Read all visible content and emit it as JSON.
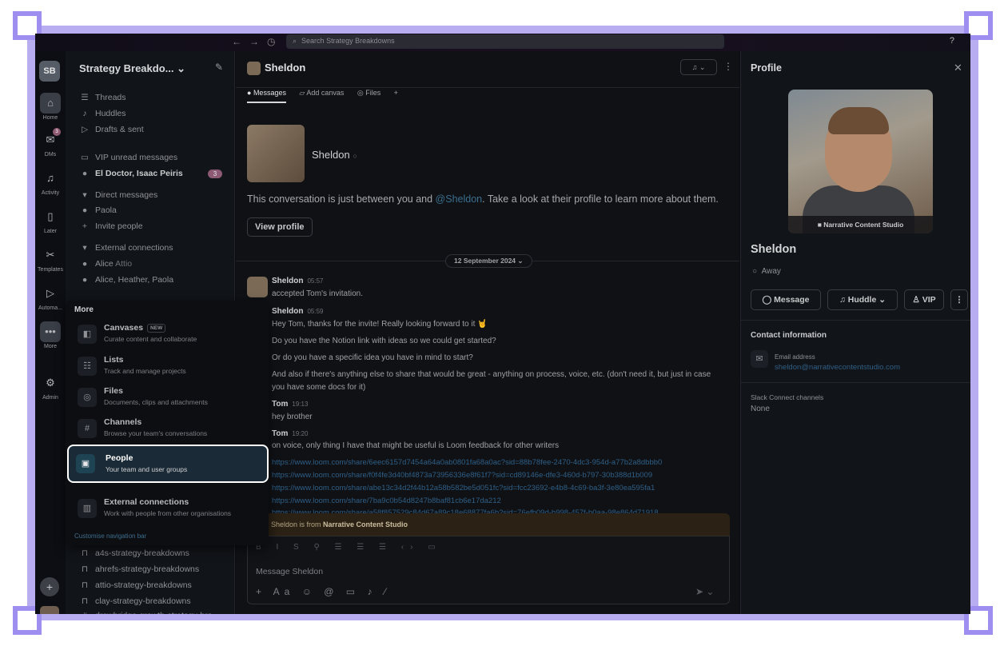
{
  "topbar": {
    "search_placeholder": "Search Strategy Breakdowns",
    "back_icon": "arrow-left-icon",
    "forward_icon": "arrow-right-icon",
    "history_icon": "clock-icon"
  },
  "rail": {
    "workspace_initials": "SB",
    "items": [
      {
        "label": "Home",
        "icon": "home-icon"
      },
      {
        "label": "DMs",
        "icon": "dms-icon",
        "badge": "3"
      },
      {
        "label": "Activity",
        "icon": "bell-icon"
      },
      {
        "label": "Later",
        "icon": "bookmark-icon"
      },
      {
        "label": "Templates",
        "icon": "templates-icon"
      },
      {
        "label": "Automa...",
        "icon": "play-icon"
      },
      {
        "label": "More",
        "icon": "more-icon"
      },
      {
        "label": "Admin",
        "icon": "gear-icon"
      }
    ]
  },
  "sidebar": {
    "workspace_name": "Strategy Breakdo...",
    "items": [
      {
        "label": "Threads"
      },
      {
        "label": "Huddles"
      },
      {
        "label": "Drafts & sent"
      },
      {
        "label": "VIP unread messages"
      },
      {
        "label": "El Doctor, Isaac Peiris",
        "badge": "3"
      },
      {
        "label": "Direct messages"
      },
      {
        "label": "Paola"
      },
      {
        "label": "Invite people"
      },
      {
        "label": "External connections"
      },
      {
        "label": "Alice",
        "suffix": "Attio"
      },
      {
        "label": "Alice, Heather, Paola"
      }
    ],
    "channels": [
      "a4s-strategy-breakdowns",
      "ahrefs-strategy-breakdowns",
      "attio-strategy-breakdowns",
      "clay-strategy-breakdowns",
      "drawbridge-growth-strategy-bre"
    ]
  },
  "more_menu": {
    "title": "More",
    "items": [
      {
        "title": "Canvases",
        "tag": "NEW",
        "subtitle": "Curate content and collaborate"
      },
      {
        "title": "Lists",
        "subtitle": "Track and manage projects"
      },
      {
        "title": "Files",
        "subtitle": "Documents, clips and attachments"
      },
      {
        "title": "Channels",
        "subtitle": "Browse your team's conversations"
      },
      {
        "title": "People",
        "subtitle": "Your team and user groups"
      },
      {
        "title": "External connections",
        "subtitle": "Work with people from other organisations"
      }
    ],
    "footer": "Customise navigation bar"
  },
  "channel": {
    "name": "Sheldon",
    "tabs": [
      "Messages",
      "Add canvas",
      "Files"
    ],
    "intro_name": "Sheldon",
    "intro_text_before": "This conversation is just between you and ",
    "intro_mention": "@Sheldon",
    "intro_text_after": ". Take a look at their profile to learn more about them.",
    "view_profile": "View profile",
    "date_divider": "12 September 2024"
  },
  "messages": [
    {
      "author": "Sheldon",
      "time": "05:57",
      "lines": [
        "accepted Tom's invitation."
      ]
    },
    {
      "author": "Sheldon",
      "time": "05:59",
      "lines": [
        "Hey Tom, thanks for the invite! Really looking forward to it 🤘",
        "Do you have the Notion link with ideas so we could get started?",
        "Or do you have a specific idea you have in mind to start?",
        "And also if there's anything else to share that would be great - anything on process, voice, etc. (don't need it, but just in case",
        "you have some docs for it)"
      ]
    },
    {
      "author": "Tom",
      "time": "19:13",
      "lines": [
        "hey brother"
      ]
    },
    {
      "author": "Tom",
      "time": "19:20",
      "lines": [
        "on voice, only thing I have that might be useful is Loom feedback for other writers"
      ]
    }
  ],
  "links": [
    "https://www.loom.com/share/6eec6157d7454a64a0ab0801fa68a0ac?sid=88b78fee-2470-4dc3-954d-a77b2a8dbbb0",
    "https://www.loom.com/share/f0f4fe3d40bf4873a73956336e8f61f7?sid=cd89146e-dfe3-460d-b797-30b388d1b009",
    "https://www.loom.com/share/abe13c34d2f44b12a58b582be5d051fc?sid=fcc23692-e4b8-4c69-ba3f-3e80ea595fa1",
    "https://www.loom.com/share/7ba9c0b54d8247b8baf81cb6e17da212",
    "https://www.loom.com/share/a58f857529c84d67a89c18e68877fa6b?sid=76efb09d-b998-457f-b0aa-98e864d71918"
  ],
  "composer": {
    "banner_prefix": "Sheldon is from ",
    "banner_org": "Narrative Content Studio",
    "placeholder": "Message Sheldon"
  },
  "profile": {
    "title": "Profile",
    "org": "Narrative Content Studio",
    "name": "Sheldon",
    "status": "Away",
    "buttons": [
      "Message",
      "Huddle",
      "VIP"
    ],
    "contact_title": "Contact information",
    "email_label": "Email address",
    "email": "sheldon@narrativecontentstudio.com",
    "slack_connect_label": "Slack Connect channels",
    "slack_connect_value": "None"
  },
  "colors": {
    "frame": "#9d8ef0",
    "highlight_border": "#ffffff",
    "link": "#2f5f86"
  }
}
